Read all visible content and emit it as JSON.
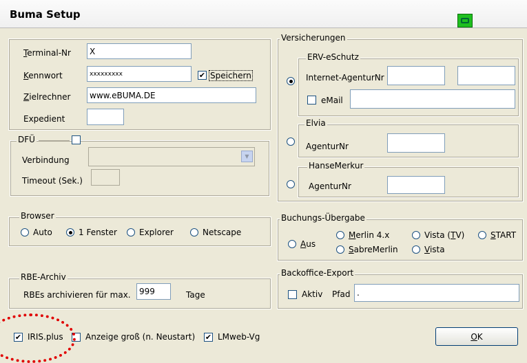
{
  "window": {
    "title": "Buma Setup",
    "title_icon": "printer-icon"
  },
  "login": {
    "terminal_label_u": "T",
    "terminal_label_rest": "erminal-Nr",
    "terminal_value": "X",
    "password_label_u": "K",
    "password_label_rest": "ennwort",
    "password_value": "xxxxxxxxx",
    "save_label": "Speichern",
    "save_checked": true,
    "target_label_u": "Z",
    "target_label_rest": "ielrechner",
    "target_value": "www.eBUMA.DE",
    "expedient_label": "Expedient",
    "expedient_value": ""
  },
  "dfu": {
    "legend": "DFÜ",
    "enabled": false,
    "connection_label": "Verbindung",
    "connection_value": "",
    "timeout_label": "Timeout (Sek.)",
    "timeout_value": ""
  },
  "browser": {
    "legend": "Browser",
    "options": [
      {
        "label": "Auto",
        "selected": false
      },
      {
        "label": "1 Fenster",
        "selected": true
      },
      {
        "label": "Explorer",
        "selected": false
      },
      {
        "label": "Netscape",
        "selected": false
      }
    ]
  },
  "rbe": {
    "legend": "RBE-Archiv",
    "prefix": "RBEs archivieren für max.",
    "value": "999",
    "suffix": "Tage"
  },
  "bottom": {
    "iris_label": "IRIS.plus",
    "iris_checked": true,
    "display_label": "Anzeige groß (n. Neustart)",
    "display_checked": false,
    "lmweb_label": "LMweb-Vg",
    "lmweb_checked": true,
    "ok_label_u": "O",
    "ok_label_rest": "K"
  },
  "insurance": {
    "legend": "Versicherungen",
    "erv": {
      "legend": "ERV-eSchutz",
      "selected": true,
      "agent_label": "Internet-AgenturNr",
      "agent_value1": "",
      "agent_value2": "",
      "email_label": "eMail",
      "email_checked": false,
      "email_value": ""
    },
    "elvia": {
      "legend": "Elvia",
      "selected": false,
      "agent_label": "AgenturNr",
      "agent_value": ""
    },
    "hanse": {
      "legend": "HanseMerkur",
      "selected": false,
      "agent_label": "AgenturNr",
      "agent_value": ""
    }
  },
  "booking": {
    "legend": "Buchungs-Übergabe",
    "aus_u": "A",
    "aus_rest": "us",
    "merlin_u": "M",
    "merlin_rest": "erlin 4.x",
    "vistatv_pre": "Vista (",
    "vistatv_u": "T",
    "vistatv_post": "V)",
    "start_u": "S",
    "start_rest": "TART",
    "sabre_u": "S",
    "sabre_rest": "abreMerlin",
    "vista_u": "V",
    "vista_rest": "ista"
  },
  "backoffice": {
    "legend": "Backoffice-Export",
    "active_label": "Aktiv",
    "active_checked": false,
    "path_label": "Pfad",
    "path_value": "."
  }
}
